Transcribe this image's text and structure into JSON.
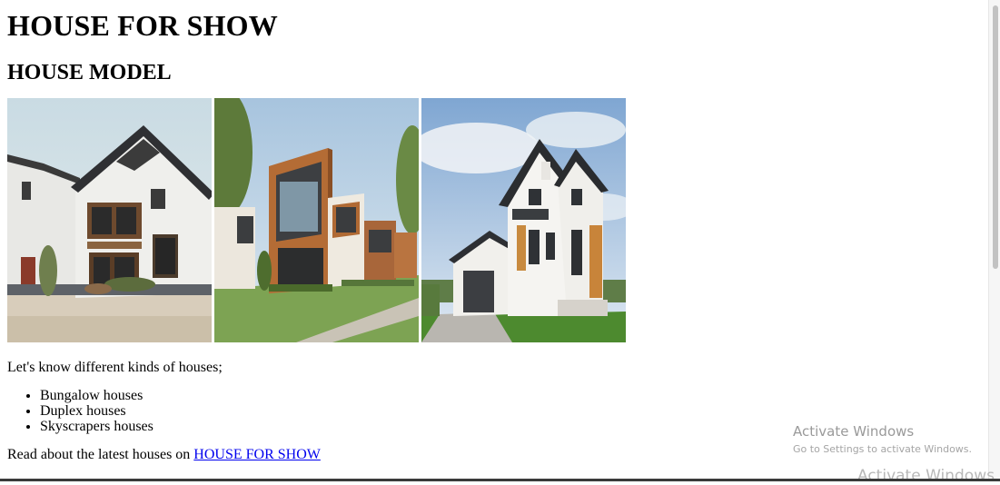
{
  "page": {
    "title": "HOUSE FOR SHOW",
    "subtitle": "HOUSE MODEL"
  },
  "gallery": {
    "images": [
      {
        "name": "chinese-style-house-photo",
        "icon": "house-photo-icon"
      },
      {
        "name": "modern-wooden-house-photo",
        "icon": "house-photo-icon"
      },
      {
        "name": "white-gabled-house-photo",
        "icon": "house-photo-icon"
      }
    ]
  },
  "content": {
    "intro": "Let's know different kinds of houses;",
    "kinds": [
      "Bungalow houses",
      "Duplex houses",
      "Skyscrapers houses"
    ],
    "read_prefix": "Read about the latest houses on ",
    "link_text": "HOUSE FOR SHOW"
  },
  "watermark": {
    "title": "Activate Windows",
    "subtitle": "Go to Settings to activate Windows.",
    "ghost": "Activate Windows"
  },
  "colors": {
    "link": "#0000ee",
    "background": "#ffffff"
  }
}
